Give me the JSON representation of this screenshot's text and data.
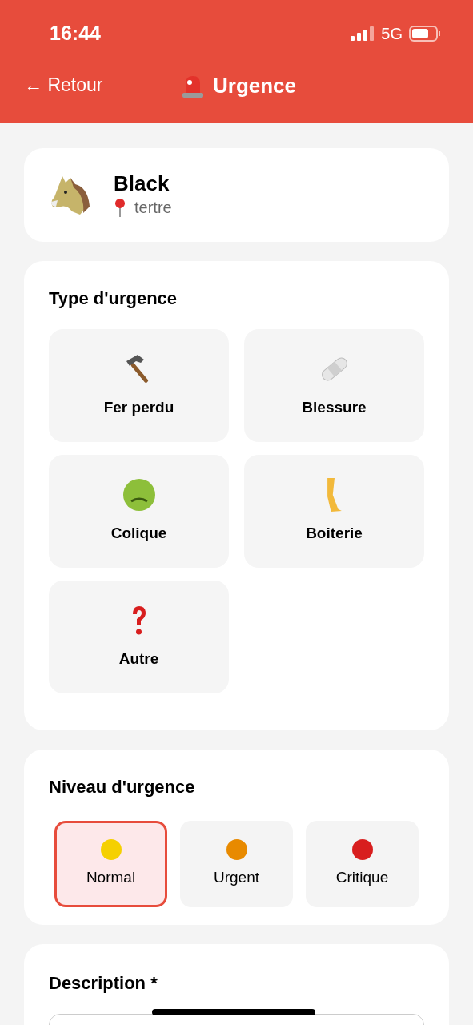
{
  "status_bar": {
    "time": "16:44",
    "network": "5G"
  },
  "nav": {
    "back": "← Retour",
    "title": "Urgence"
  },
  "horse": {
    "name": "Black",
    "location": "tertre"
  },
  "emergency_type": {
    "title": "Type d'urgence",
    "options": [
      {
        "label": "Fer perdu",
        "kind": "hammer",
        "selected": false
      },
      {
        "label": "Blessure",
        "kind": "bandage",
        "selected": false
      },
      {
        "label": "Colique",
        "kind": "sick",
        "selected": false
      },
      {
        "label": "Boiterie",
        "kind": "leg",
        "selected": false
      },
      {
        "label": "Autre",
        "kind": "question",
        "selected": false
      }
    ]
  },
  "urgency_level": {
    "title": "Niveau d'urgence",
    "options": [
      {
        "label": "Normal",
        "color": "#f5d000",
        "selected": true
      },
      {
        "label": "Urgent",
        "color": "#e88a00",
        "selected": false
      },
      {
        "label": "Critique",
        "color": "#d81e1e",
        "selected": false
      }
    ]
  },
  "description": {
    "title": "Description *"
  }
}
